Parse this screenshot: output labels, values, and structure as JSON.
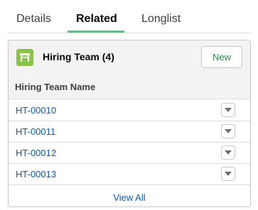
{
  "tabs": [
    {
      "label": "Details"
    },
    {
      "label": "Related"
    },
    {
      "label": "Longlist"
    }
  ],
  "card": {
    "title": "Hiring Team (4)",
    "icon": "desk-icon",
    "new_button_label": "New",
    "column_header": "Hiring Team Name",
    "rows": [
      {
        "name": "HT-00010"
      },
      {
        "name": "HT-00011"
      },
      {
        "name": "HT-00012"
      },
      {
        "name": "HT-00013"
      }
    ],
    "view_all_label": "View All"
  },
  "colors": {
    "accent_underline": "#4bca81",
    "icon_background": "#8bc34a",
    "link": "#0b5cab",
    "new_button_text": "#2e844a"
  }
}
